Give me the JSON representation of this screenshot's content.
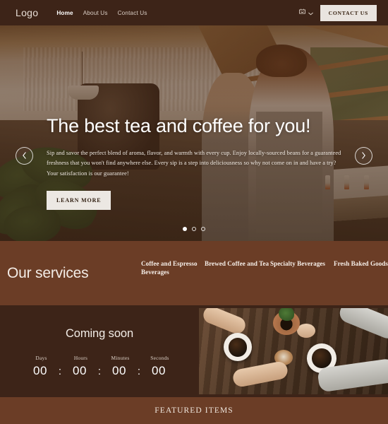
{
  "header": {
    "logo": "Logo",
    "nav": [
      {
        "label": "Home",
        "active": true
      },
      {
        "label": "About Us",
        "active": false
      },
      {
        "label": "Contact Us",
        "active": false
      }
    ],
    "cart_icon": "shopping-cart-icon",
    "chevron_icon": "chevron-down-icon",
    "contact_button": "CONTACT US",
    "background_color": "#3d2418"
  },
  "hero": {
    "title": "The best tea and coffee for you!",
    "body": "Sip and savor the perfect blend of aroma, flavor, and warmth with every cup. Enjoy locally-sourced beans for a guaranteed freshness that you won't find anywhere else. Every sip is a step into deliciousness so why not come on in and have a try? Your satisfaction is our guarantee!",
    "cta_label": "LEARN MORE",
    "prev_icon": "chevron-left-icon",
    "next_icon": "chevron-right-icon",
    "slides": [
      {
        "active": true
      },
      {
        "active": false
      },
      {
        "active": false
      }
    ],
    "image_description": "Two baristas preparing coffee inside a bright cafe with a monstera plant and espresso machine",
    "overlay_color": "#4a2a16"
  },
  "services": {
    "title": "Our services",
    "background_color": "#6b3d26",
    "columns": [
      {
        "label": "Coffee and Espresso Beverages"
      },
      {
        "label": "Brewed Coffee and Tea"
      },
      {
        "label": "Specialty Beverages"
      },
      {
        "label": "Fresh Baked Goods"
      }
    ]
  },
  "coming_soon": {
    "title": "Coming soon",
    "background_color": "#3d2418",
    "countdown": [
      {
        "label": "Days",
        "value": "00"
      },
      {
        "label": "Hours",
        "value": "00"
      },
      {
        "label": "Minutes",
        "value": "00"
      },
      {
        "label": "Seconds",
        "value": "00"
      }
    ],
    "separator": ":",
    "image_description": "Overhead view of two people holding hands across a wooden table with two cups of coffee and a small potted plant"
  },
  "featured": {
    "title": "FEATURED ITEMS",
    "background_color": "#6b3d26"
  }
}
